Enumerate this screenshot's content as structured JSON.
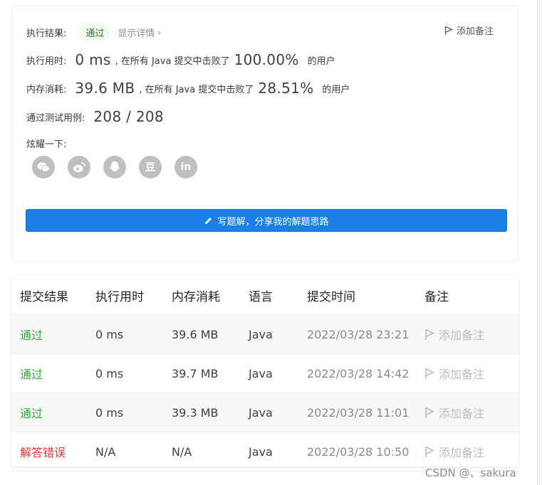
{
  "summary": {
    "result_label": "执行结果:",
    "result_badge": "通过",
    "details_link": "显示详情",
    "add_note": "添加备注",
    "runtime_label": "执行用时:",
    "runtime_value": "0 ms",
    "runtime_mid": ", 在所有 Java 提交中击败了",
    "runtime_pct": "100.00%",
    "runtime_tail": "的用户",
    "memory_label": "内存消耗:",
    "memory_value": "39.6 MB",
    "memory_mid": ", 在所有 Java 提交中击败了",
    "memory_pct": "28.51%",
    "memory_tail": "的用户",
    "tests_label": "通过测试用例:",
    "tests_value": "208 / 208",
    "share_label": "炫耀一下:",
    "share_icons": [
      "wechat-icon",
      "weibo-icon",
      "qq-icon",
      "douban-icon",
      "linkedin-icon"
    ],
    "douban_glyph": "豆",
    "linkedin_glyph": "in",
    "write_button": "写题解，分享我的解题思路"
  },
  "table": {
    "headers": [
      "提交结果",
      "执行用时",
      "内存消耗",
      "语言",
      "提交时间",
      "备注"
    ],
    "rows": [
      {
        "result": "通过",
        "status": "pass",
        "runtime": "0 ms",
        "memory": "39.6 MB",
        "lang": "Java",
        "time": "2022/03/28 23:21",
        "note": "添加备注"
      },
      {
        "result": "通过",
        "status": "pass",
        "runtime": "0 ms",
        "memory": "39.7 MB",
        "lang": "Java",
        "time": "2022/03/28 14:42",
        "note": "添加备注"
      },
      {
        "result": "通过",
        "status": "pass",
        "runtime": "0 ms",
        "memory": "39.3 MB",
        "lang": "Java",
        "time": "2022/03/28 11:01",
        "note": "添加备注"
      },
      {
        "result": "解答错误",
        "status": "fail",
        "runtime": "N/A",
        "memory": "N/A",
        "lang": "Java",
        "time": "2022/03/28 10:50",
        "note": "添加备注"
      }
    ]
  },
  "watermark": "CSDN @、sakura",
  "colors": {
    "accent": "#1a7fe8",
    "pass": "#34a83c",
    "fail": "#e03a3a"
  }
}
